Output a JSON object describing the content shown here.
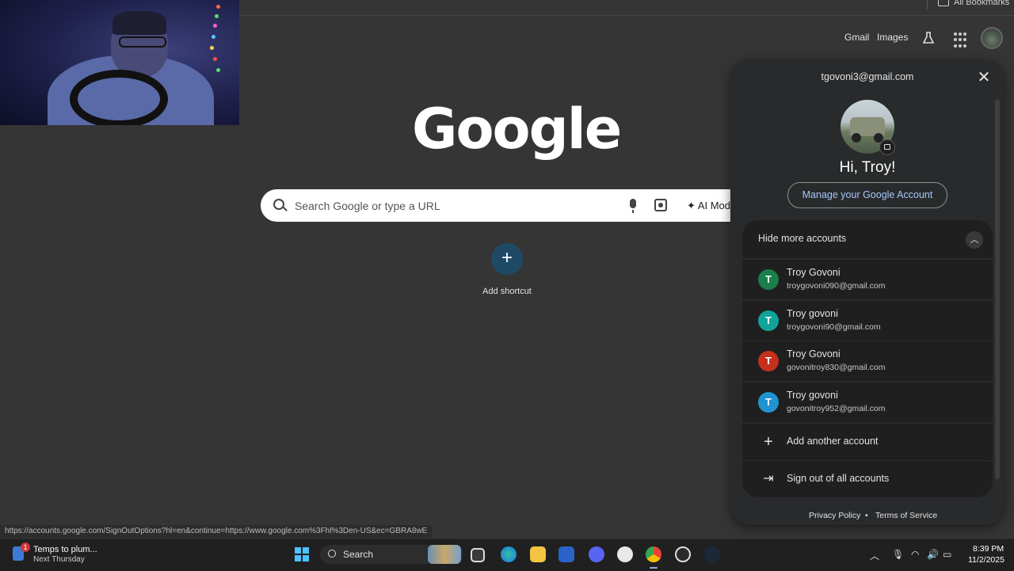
{
  "bookmarks_bar": {
    "all_bookmarks": "All Bookmarks"
  },
  "header": {
    "gmail": "Gmail",
    "images": "Images",
    "labs_icon": "flask-icon",
    "apps_icon": "apps-grid-icon"
  },
  "logo": {
    "text": "Google"
  },
  "search": {
    "placeholder": "Search Google or type a URL",
    "ai_mode": "AI Mod"
  },
  "shortcut": {
    "icon": "+",
    "label": "Add shortcut"
  },
  "account_panel": {
    "email": "tgovoni3@gmail.com",
    "greeting": "Hi, Troy!",
    "manage_label": "Manage your Google Account",
    "hide_more_label": "Hide more accounts",
    "accounts": [
      {
        "initial": "T",
        "name": "Troy Govoni",
        "email": "troygovoni090@gmail.com",
        "color": "#1a7f4b"
      },
      {
        "initial": "T",
        "name": "Troy govoni",
        "email": "troygovoni90@gmail.com",
        "color": "#12a39a"
      },
      {
        "initial": "T",
        "name": "Troy Govoni",
        "email": "govonitroy830@gmail.com",
        "color": "#c5301c"
      },
      {
        "initial": "T",
        "name": "Troy govoni",
        "email": "govonitroy952@gmail.com",
        "color": "#1f94d1"
      }
    ],
    "add_account": "Add another account",
    "sign_out_all": "Sign out of all accounts",
    "privacy": "Privacy Policy",
    "separator": "•",
    "terms": "Terms of Service"
  },
  "status_url": "https://accounts.google.com/SignOutOptions?hl=en&continue=https://www.google.com%3Fhl%3Den-US&ec=GBRA8wE",
  "taskbar": {
    "weather_title": "Temps to plum...",
    "weather_sub": "Next Thursday",
    "notification_count": "1",
    "search_label": "Search",
    "time": "8:39 PM",
    "date": "11/2/2025"
  }
}
